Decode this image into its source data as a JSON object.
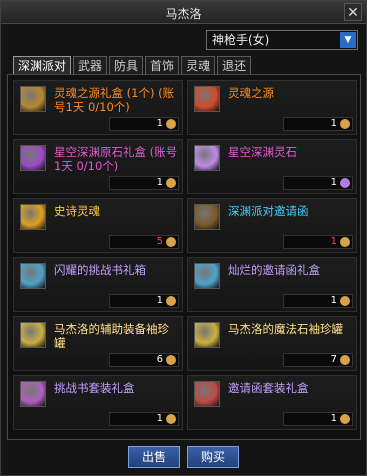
{
  "window": {
    "title": "马杰洛",
    "close_label": "✕"
  },
  "job_select": {
    "value": "神枪手(女)"
  },
  "tabs": [
    {
      "label": "深渊派对",
      "active": true
    },
    {
      "label": "武器"
    },
    {
      "label": "防具"
    },
    {
      "label": "首饰"
    },
    {
      "label": "灵魂"
    },
    {
      "label": "退还"
    }
  ],
  "items": [
    {
      "name": "灵魂之源礼盒 (1个) (账号1天 0/10个)",
      "price": "1",
      "color": "#ff8a1f",
      "icon": "chest-icon",
      "icon_color": "#b8892e",
      "coin": "#d8a24a"
    },
    {
      "name": "灵魂之源",
      "price": "1",
      "color": "#ff8a1f",
      "icon": "soul-gem-icon",
      "icon_color": "#d24b2a",
      "coin": "#d8a24a"
    },
    {
      "name": "星空深渊原石礼盒 (账号1天 0/10个)",
      "price": "1",
      "color": "#e05ad0",
      "icon": "star-gift-icon",
      "icon_color": "#9b4bc7",
      "coin": "#d8a24a"
    },
    {
      "name": "星空深渊灵石",
      "price": "1",
      "color": "#e05ad0",
      "icon": "abyss-stone-icon",
      "icon_color": "#c08ae6",
      "coin": "#b47ae6"
    },
    {
      "name": "史诗灵魂",
      "price": "5",
      "color": "#ffcc33",
      "icon": "epic-soul-icon",
      "icon_color": "#e0a020",
      "price_color": "#ff4444",
      "coin": "#d8a24a"
    },
    {
      "name": "深渊派对邀请函",
      "price": "1",
      "color": "#3fd0ff",
      "icon": "invitation-icon",
      "icon_color": "#7a5a2a",
      "price_color": "#ff4444",
      "coin": "#d8a24a"
    },
    {
      "name": "闪耀的挑战书礼箱",
      "price": "1",
      "color": "#c0a0ff",
      "icon": "challenge-box-icon",
      "icon_color": "#4fa3c9",
      "coin": "#d8a24a"
    },
    {
      "name": "灿烂的邀请函礼盒",
      "price": "1",
      "color": "#c0a0ff",
      "icon": "invite-box-icon",
      "icon_color": "#4fa3c9",
      "coin": "#d8a24a"
    },
    {
      "name": "马杰洛的辅助装备袖珍罐",
      "price": "6",
      "color": "#ffe08a",
      "icon": "jar-icon",
      "icon_color": "#c9b040",
      "coin": "#d8a24a"
    },
    {
      "name": "马杰洛的魔法石袖珍罐",
      "price": "7",
      "color": "#ffe08a",
      "icon": "magic-jar-icon",
      "icon_color": "#c9b040",
      "coin": "#d8a24a"
    },
    {
      "name": "挑战书套装礼盒",
      "price": "1",
      "color": "#c0a0ff",
      "icon": "challenge-set-icon",
      "icon_color": "#b060c0",
      "coin": "#d8a24a"
    },
    {
      "name": "邀请函套装礼盒",
      "price": "1",
      "color": "#c0a0ff",
      "icon": "invite-set-icon",
      "icon_color": "#c04848",
      "coin": "#d8a24a"
    }
  ],
  "footer": {
    "sell_label": "出售",
    "buy_label": "购买"
  }
}
